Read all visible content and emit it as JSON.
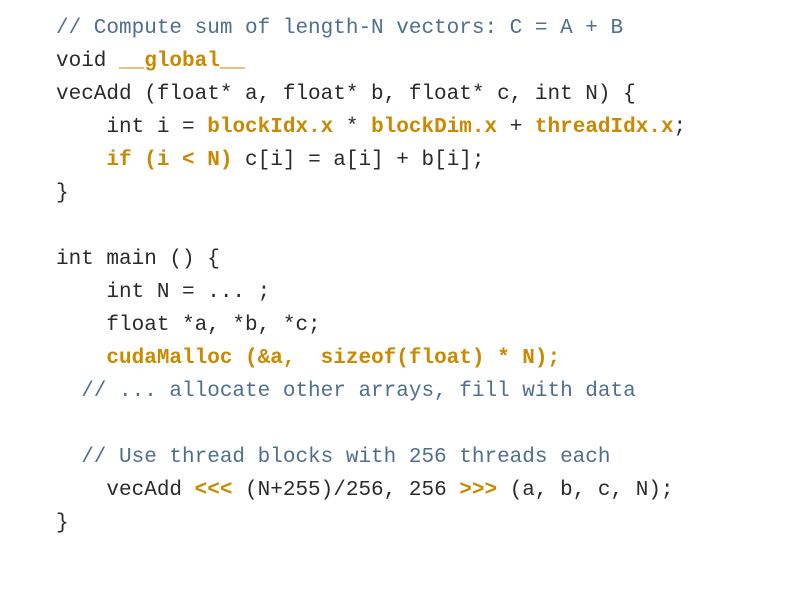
{
  "code": {
    "l01_comment": "// Compute sum of length-N vectors: C = A + B",
    "l02_a": "void ",
    "l02_b": "__global__",
    "l03": "vecAdd (float* a, float* b, float* c, int N) {",
    "l04_a": "    int i = ",
    "l04_b": "blockIdx.x",
    "l04_c": " * ",
    "l04_d": "blockDim.x",
    "l04_e": " + ",
    "l04_f": "threadIdx.x",
    "l04_g": ";",
    "l05_a": "    ",
    "l05_b": "if (i < N)",
    "l05_c": " c[i] = a[i] + b[i];",
    "l06": "}",
    "l07": "",
    "l08": "int main () {",
    "l09": "    int N = ... ;",
    "l10": "    float *a, *b, *c;",
    "l11_a": "    ",
    "l11_b": "cudaMalloc (&a,  sizeof(float) * N);",
    "l12": "  // ... allocate other arrays, fill with data",
    "l13": "",
    "l14": "  // Use thread blocks with 256 threads each",
    "l15_a": "    vecAdd ",
    "l15_b": "<<<",
    "l15_c": " (N+255)/256, 256 ",
    "l15_d": ">>>",
    "l15_e": " (a, b, c, N);",
    "l16": "}"
  }
}
